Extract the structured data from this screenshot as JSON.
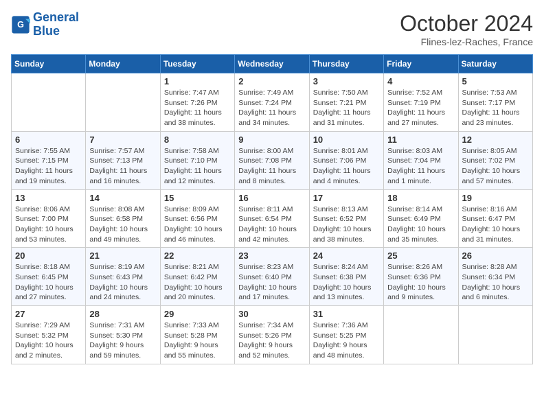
{
  "logo": {
    "text_general": "General",
    "text_blue": "Blue"
  },
  "header": {
    "month_title": "October 2024",
    "subtitle": "Flines-lez-Raches, France"
  },
  "weekdays": [
    "Sunday",
    "Monday",
    "Tuesday",
    "Wednesday",
    "Thursday",
    "Friday",
    "Saturday"
  ],
  "weeks": [
    [
      {
        "day": "",
        "info": ""
      },
      {
        "day": "",
        "info": ""
      },
      {
        "day": "1",
        "info": "Sunrise: 7:47 AM\nSunset: 7:26 PM\nDaylight: 11 hours and 38 minutes."
      },
      {
        "day": "2",
        "info": "Sunrise: 7:49 AM\nSunset: 7:24 PM\nDaylight: 11 hours and 34 minutes."
      },
      {
        "day": "3",
        "info": "Sunrise: 7:50 AM\nSunset: 7:21 PM\nDaylight: 11 hours and 31 minutes."
      },
      {
        "day": "4",
        "info": "Sunrise: 7:52 AM\nSunset: 7:19 PM\nDaylight: 11 hours and 27 minutes."
      },
      {
        "day": "5",
        "info": "Sunrise: 7:53 AM\nSunset: 7:17 PM\nDaylight: 11 hours and 23 minutes."
      }
    ],
    [
      {
        "day": "6",
        "info": "Sunrise: 7:55 AM\nSunset: 7:15 PM\nDaylight: 11 hours and 19 minutes."
      },
      {
        "day": "7",
        "info": "Sunrise: 7:57 AM\nSunset: 7:13 PM\nDaylight: 11 hours and 16 minutes."
      },
      {
        "day": "8",
        "info": "Sunrise: 7:58 AM\nSunset: 7:10 PM\nDaylight: 11 hours and 12 minutes."
      },
      {
        "day": "9",
        "info": "Sunrise: 8:00 AM\nSunset: 7:08 PM\nDaylight: 11 hours and 8 minutes."
      },
      {
        "day": "10",
        "info": "Sunrise: 8:01 AM\nSunset: 7:06 PM\nDaylight: 11 hours and 4 minutes."
      },
      {
        "day": "11",
        "info": "Sunrise: 8:03 AM\nSunset: 7:04 PM\nDaylight: 11 hours and 1 minute."
      },
      {
        "day": "12",
        "info": "Sunrise: 8:05 AM\nSunset: 7:02 PM\nDaylight: 10 hours and 57 minutes."
      }
    ],
    [
      {
        "day": "13",
        "info": "Sunrise: 8:06 AM\nSunset: 7:00 PM\nDaylight: 10 hours and 53 minutes."
      },
      {
        "day": "14",
        "info": "Sunrise: 8:08 AM\nSunset: 6:58 PM\nDaylight: 10 hours and 49 minutes."
      },
      {
        "day": "15",
        "info": "Sunrise: 8:09 AM\nSunset: 6:56 PM\nDaylight: 10 hours and 46 minutes."
      },
      {
        "day": "16",
        "info": "Sunrise: 8:11 AM\nSunset: 6:54 PM\nDaylight: 10 hours and 42 minutes."
      },
      {
        "day": "17",
        "info": "Sunrise: 8:13 AM\nSunset: 6:52 PM\nDaylight: 10 hours and 38 minutes."
      },
      {
        "day": "18",
        "info": "Sunrise: 8:14 AM\nSunset: 6:49 PM\nDaylight: 10 hours and 35 minutes."
      },
      {
        "day": "19",
        "info": "Sunrise: 8:16 AM\nSunset: 6:47 PM\nDaylight: 10 hours and 31 minutes."
      }
    ],
    [
      {
        "day": "20",
        "info": "Sunrise: 8:18 AM\nSunset: 6:45 PM\nDaylight: 10 hours and 27 minutes."
      },
      {
        "day": "21",
        "info": "Sunrise: 8:19 AM\nSunset: 6:43 PM\nDaylight: 10 hours and 24 minutes."
      },
      {
        "day": "22",
        "info": "Sunrise: 8:21 AM\nSunset: 6:42 PM\nDaylight: 10 hours and 20 minutes."
      },
      {
        "day": "23",
        "info": "Sunrise: 8:23 AM\nSunset: 6:40 PM\nDaylight: 10 hours and 17 minutes."
      },
      {
        "day": "24",
        "info": "Sunrise: 8:24 AM\nSunset: 6:38 PM\nDaylight: 10 hours and 13 minutes."
      },
      {
        "day": "25",
        "info": "Sunrise: 8:26 AM\nSunset: 6:36 PM\nDaylight: 10 hours and 9 minutes."
      },
      {
        "day": "26",
        "info": "Sunrise: 8:28 AM\nSunset: 6:34 PM\nDaylight: 10 hours and 6 minutes."
      }
    ],
    [
      {
        "day": "27",
        "info": "Sunrise: 7:29 AM\nSunset: 5:32 PM\nDaylight: 10 hours and 2 minutes."
      },
      {
        "day": "28",
        "info": "Sunrise: 7:31 AM\nSunset: 5:30 PM\nDaylight: 9 hours and 59 minutes."
      },
      {
        "day": "29",
        "info": "Sunrise: 7:33 AM\nSunset: 5:28 PM\nDaylight: 9 hours and 55 minutes."
      },
      {
        "day": "30",
        "info": "Sunrise: 7:34 AM\nSunset: 5:26 PM\nDaylight: 9 hours and 52 minutes."
      },
      {
        "day": "31",
        "info": "Sunrise: 7:36 AM\nSunset: 5:25 PM\nDaylight: 9 hours and 48 minutes."
      },
      {
        "day": "",
        "info": ""
      },
      {
        "day": "",
        "info": ""
      }
    ]
  ]
}
